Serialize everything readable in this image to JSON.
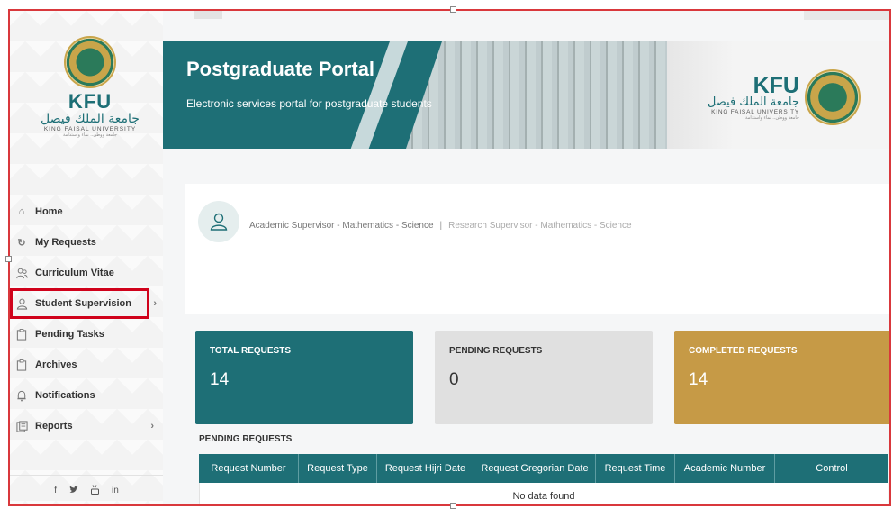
{
  "brand": {
    "short": "KFU",
    "arabic": "جامعة الملك فيصل",
    "english": "KING FAISAL UNIVERSITY",
    "tagline": "جامعة ووطن.. نماء واستدامة"
  },
  "sidebar": {
    "items": [
      {
        "label": "Home",
        "icon": "home-icon"
      },
      {
        "label": "My Requests",
        "icon": "refresh-icon"
      },
      {
        "label": "Curriculum Vitae",
        "icon": "users-icon"
      },
      {
        "label": "Student Supervision",
        "icon": "user-icon",
        "highlighted": true
      },
      {
        "label": "Pending Tasks",
        "icon": "clipboard-icon"
      },
      {
        "label": "Archives",
        "icon": "clipboard-icon"
      },
      {
        "label": "Notifications",
        "icon": "bell-icon"
      },
      {
        "label": "Reports",
        "icon": "document-icon"
      }
    ],
    "social": [
      "f",
      "♥",
      "▣",
      "in"
    ]
  },
  "banner": {
    "title": "Postgraduate Portal",
    "subtitle": "Electronic services portal for postgraduate students"
  },
  "profile": {
    "role1": "Academic Supervisor - Mathematics - Science",
    "role2": "Research Supervisor - Mathematics - Science"
  },
  "cards": {
    "total": {
      "title": "TOTAL REQUESTS",
      "value": "14"
    },
    "pending": {
      "title": "PENDING REQUESTS",
      "value": "0"
    },
    "completed": {
      "title": "COMPLETED REQUESTS",
      "value": "14"
    }
  },
  "pending_section": {
    "title": "PENDING REQUESTS",
    "columns": [
      "Request Number",
      "Request Type",
      "Request Hijri Date",
      "Request Gregorian Date",
      "Request Time",
      "Academic Number",
      "Control"
    ],
    "empty_text": "No data found"
  },
  "colors": {
    "brand_teal": "#1e6f76",
    "gold": "#c69a46",
    "highlight": "#d0021b"
  }
}
